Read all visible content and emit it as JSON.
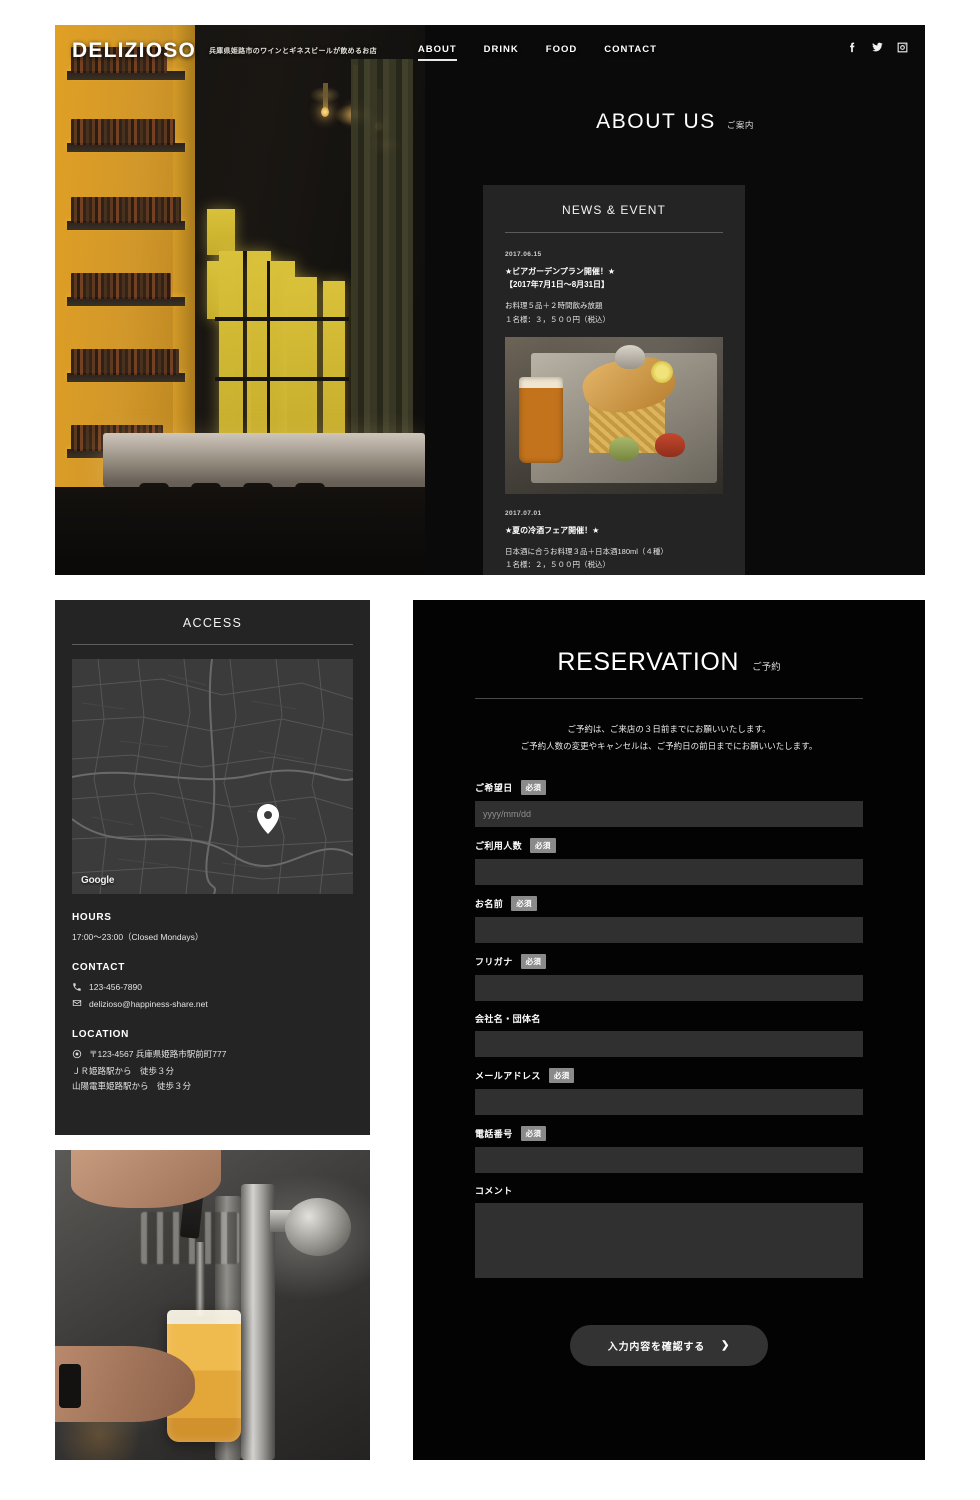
{
  "site": {
    "brand": "DELIZIOSO",
    "tagline": "兵庫県姫路市のワインとギネスビールが飲めるお店"
  },
  "nav": {
    "items": [
      {
        "label": "ABOUT",
        "active": true
      },
      {
        "label": "DRINK",
        "active": false
      },
      {
        "label": "FOOD",
        "active": false
      },
      {
        "label": "CONTACT",
        "active": false
      }
    ]
  },
  "socials": [
    {
      "name": "facebook-icon"
    },
    {
      "name": "twitter-icon"
    },
    {
      "name": "instagram-icon"
    }
  ],
  "about": {
    "title_en": "ABOUT US",
    "title_jp": "ご案内"
  },
  "news": {
    "title": "NEWS & EVENT",
    "items": [
      {
        "date": "2017.06.15",
        "headline_line1": "★ビアガーデンプラン開催！★",
        "headline_line2": "【2017年7月1日〜8月31日】",
        "body_line1": "お料理５品＋２時間飲み放題",
        "body_line2": "１名様：３，５００円（税込）",
        "has_photo": true
      },
      {
        "date": "2017.07.01",
        "headline_line1": "★夏の冷酒フェア開催！★",
        "headline_line2": "",
        "body_line1": "日本酒に合うお料理３品＋日本酒180ml（４種）",
        "body_line2": "１名様：２，５００円（税込）",
        "has_photo": false
      }
    ]
  },
  "access": {
    "title": "ACCESS",
    "map_attribution": "Google",
    "hours": {
      "heading": "HOURS",
      "value": "17:00〜23:00（Closed Mondays）"
    },
    "contact": {
      "heading": "CONTACT",
      "phone": "123-456-7890",
      "email": "delizioso@happiness-share.net"
    },
    "location": {
      "heading": "LOCATION",
      "address": "〒123-4567 兵庫県姫路市駅前町777",
      "route1": "ＪＲ姫路駅から　徒歩３分",
      "route2": "山陽電車姫路駅から　徒歩３分"
    }
  },
  "reservation": {
    "title_en": "RESERVATION",
    "title_jp": "ご予約",
    "note_line1": "ご予約は、ご来店の３日前までにお願いいたします。",
    "note_line2": "ご予約人数の変更やキャンセルは、ご予約日の前日までにお願いいたします。",
    "required_badge": "必須",
    "fields": [
      {
        "label": "ご希望日",
        "required": true,
        "type": "input",
        "placeholder": "yyyy/mm/dd",
        "value": ""
      },
      {
        "label": "ご利用人数",
        "required": true,
        "type": "input",
        "placeholder": "",
        "value": ""
      },
      {
        "label": "お名前",
        "required": true,
        "type": "input",
        "placeholder": "",
        "value": ""
      },
      {
        "label": "フリガナ",
        "required": true,
        "type": "input",
        "placeholder": "",
        "value": ""
      },
      {
        "label": "会社名・団体名",
        "required": false,
        "type": "input",
        "placeholder": "",
        "value": ""
      },
      {
        "label": "メールアドレス",
        "required": true,
        "type": "input",
        "placeholder": "",
        "value": ""
      },
      {
        "label": "電話番号",
        "required": true,
        "type": "input",
        "placeholder": "",
        "value": ""
      },
      {
        "label": "コメント",
        "required": false,
        "type": "textarea",
        "placeholder": "",
        "value": ""
      }
    ],
    "submit_label": "入力内容を確認する",
    "submit_chevron": "❯"
  },
  "colors": {
    "panel_bg": "#242424",
    "page_bg": "#030303",
    "input_bg": "#303030",
    "badge_bg": "#8a8a8a",
    "accent_text": "#ffffff"
  }
}
